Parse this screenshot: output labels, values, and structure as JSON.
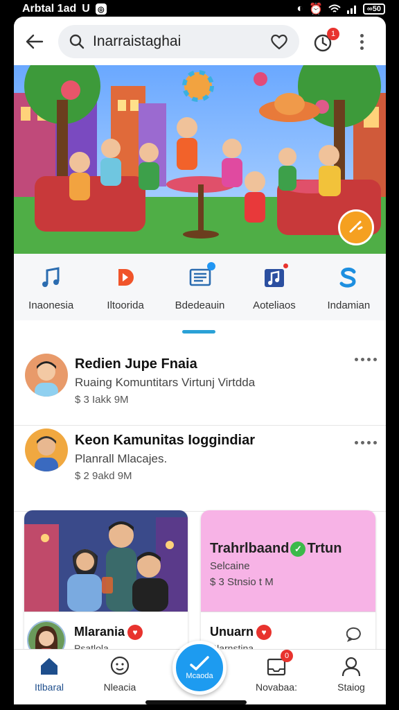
{
  "statusbar": {
    "left_text": "Arbtal 1ad",
    "battery": "∞50"
  },
  "search": {
    "value": "Inarraistaghai"
  },
  "notifications": {
    "badge": "1"
  },
  "categories": [
    {
      "label": "Inaonesia",
      "icon": "music-note-icon"
    },
    {
      "label": "Iltoorida",
      "icon": "d-play-icon"
    },
    {
      "label": "Bdedeauin",
      "icon": "list-icon"
    },
    {
      "label": "Aoteliaos",
      "icon": "music-album-icon"
    },
    {
      "label": "Indamian",
      "icon": "s-logo-icon"
    }
  ],
  "feed": [
    {
      "title": "Redien Jupe Fnaia",
      "subtitle": "Ruaing Komuntitars Virtunj Virtdda",
      "meta": "$ 3 Iakk 9M"
    },
    {
      "title": "Keon Kamunitas Ioggindiar",
      "subtitle": "Planrall Mlacajes.",
      "meta": "$ 2 9akd 9M"
    }
  ],
  "cards": [
    {
      "name": "Mlarania",
      "sub": "Psatlola"
    },
    {
      "title_a": "Trahrlbaand",
      "title_b": "Trtun",
      "subtitle": "Selcaine",
      "meta": "$ 3 Stnsio t M",
      "name": "Unuarn",
      "sub": "Rlarnstina"
    }
  ],
  "bottomnav": [
    {
      "label": "Itlbaral",
      "icon": "home-icon"
    },
    {
      "label": "Nleacia",
      "icon": "chat-smile-icon"
    },
    {
      "label": "Mcaoda",
      "icon": "compose-icon"
    },
    {
      "label": "Novabaa:",
      "icon": "inbox-icon",
      "badge": "0"
    },
    {
      "label": "Staiog",
      "icon": "profile-icon"
    }
  ],
  "colors": {
    "accent": "#1d9bf0",
    "badge": "#e8332e",
    "card_pink": "#f7b3e6"
  }
}
